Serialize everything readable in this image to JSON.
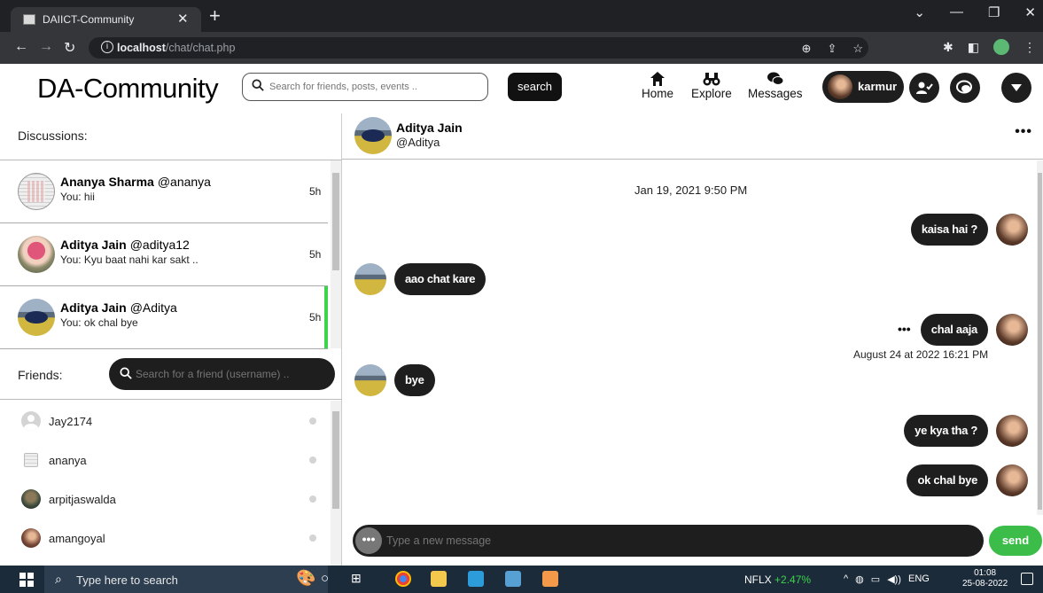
{
  "browser": {
    "tab_title": "DAIICT-Community",
    "url_host": "localhost",
    "url_path": "/chat/chat.php"
  },
  "header": {
    "logo": "DA-Community",
    "search_placeholder": "Search for friends, posts, events ..",
    "search_button": "search",
    "nav": [
      {
        "label": "Home",
        "icon": "home-icon"
      },
      {
        "label": "Explore",
        "icon": "binoculars-icon"
      },
      {
        "label": "Messages",
        "icon": "messages-icon"
      }
    ],
    "username": "karmur"
  },
  "discussions": {
    "title": "Discussions:",
    "items": [
      {
        "name": "Ananya Sharma",
        "handle": "@ananya",
        "last": "You: hii",
        "time": "5h"
      },
      {
        "name": "Aditya Jain",
        "handle": "@aditya12",
        "last": "You: Kyu baat nahi kar sakt ..",
        "time": "5h"
      },
      {
        "name": "Aditya Jain",
        "handle": "@Aditya",
        "last": "You: ok chal bye",
        "time": "5h"
      }
    ]
  },
  "friends": {
    "title": "Friends:",
    "search_placeholder": "Search for a friend (username) ..",
    "items": [
      {
        "name": "Jay2174"
      },
      {
        "name": "ananya"
      },
      {
        "name": "arpitjaswalda"
      },
      {
        "name": "amangoyal"
      }
    ]
  },
  "chat": {
    "name": "Aditya Jain",
    "handle": "@Aditya",
    "more": "•••",
    "date_stamp": "Jan 19, 2021 9:50 PM",
    "messages": [
      {
        "text": "kaisa hai ?",
        "side": "right"
      },
      {
        "text": "aao chat kare",
        "side": "left"
      },
      {
        "text": "chal aaja",
        "side": "right"
      },
      {
        "text": "bye",
        "side": "left"
      },
      {
        "text": "ye kya tha ?",
        "side": "right"
      },
      {
        "text": "ok chal bye",
        "side": "right"
      }
    ],
    "msg_timestamp": "August 24 at 2022 16:21 PM",
    "input_placeholder": "Type a new message",
    "send_label": "send"
  },
  "taskbar": {
    "search_text": "Type here to search",
    "ticker_name": "NFLX",
    "ticker_change": "+2.47%",
    "lang": "ENG",
    "time": "01:08",
    "date": "25-08-2022"
  },
  "colors": {
    "accent_green": "#3cbd4a",
    "bubble": "#1e1e1e"
  }
}
